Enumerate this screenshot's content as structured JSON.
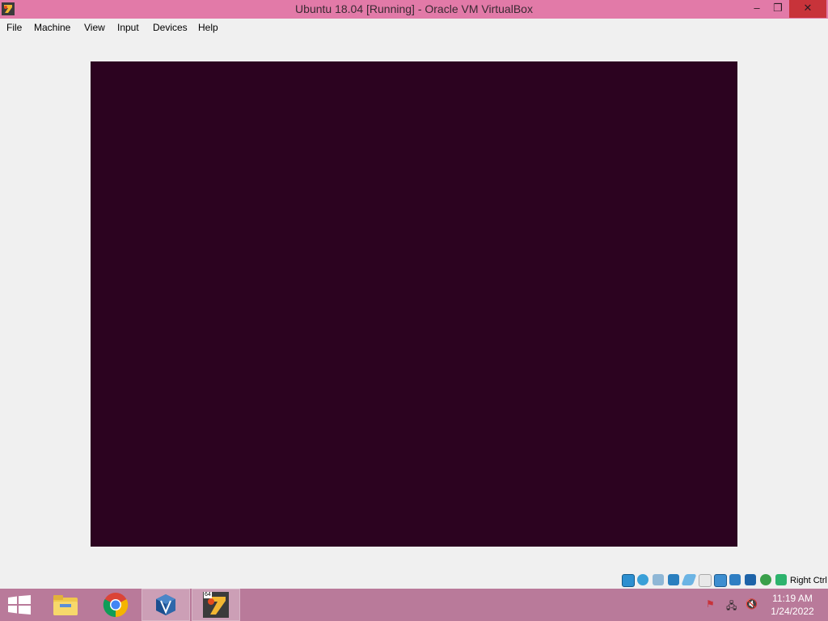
{
  "window": {
    "title": "Ubuntu 18.04 [Running] - Oracle VM VirtualBox",
    "min_label": "–",
    "max_label": "❐",
    "close_label": "✕"
  },
  "menu": {
    "items": [
      "File",
      "Machine",
      "View",
      "Input",
      "Devices",
      "Help"
    ]
  },
  "vm": {
    "screen_color": "#2c0320"
  },
  "statusbar": {
    "icons": [
      "hard-disk-icon",
      "optical-drive-icon",
      "audio-icon",
      "network-icon",
      "usb-icon",
      "shared-folders-icon",
      "display-icon",
      "video-capture-icon",
      "virtualization-icon",
      "cpu-icon",
      "mouse-integration-icon"
    ],
    "host_key": "Right Ctrl"
  },
  "taskbar": {
    "items": [
      "start-icon",
      "file-explorer-icon",
      "chrome-icon",
      "virtualbox-manager-icon",
      "virtualbox-vm-icon"
    ],
    "vm_badge": "64",
    "time": "11:19 AM",
    "date": "1/24/2022"
  },
  "colors": {
    "titlebar": "#e27aa8",
    "taskbar": "#b97a9a",
    "close": "#c8333a"
  }
}
